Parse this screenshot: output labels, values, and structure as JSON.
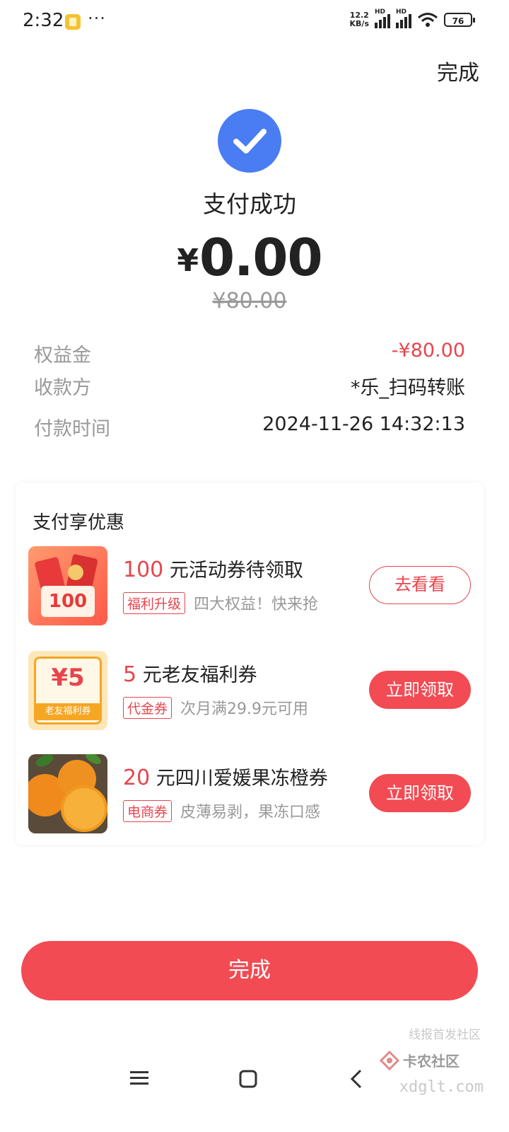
{
  "status_bar": {
    "time": "2:32",
    "dots": "···",
    "net_speed_value": "12.2",
    "net_speed_unit": "KB/s",
    "hd1": "HD",
    "hd2": "HD",
    "battery": "76"
  },
  "header": {
    "done_label": "完成"
  },
  "result": {
    "title": "支付成功",
    "currency": "¥",
    "amount": "0.00",
    "original_amount": "¥80.00"
  },
  "details": [
    {
      "label": "权益金",
      "value": "-¥80.00",
      "highlight": true
    },
    {
      "label": "收款方",
      "value": "*乐_扫码转账"
    },
    {
      "label": "付款时间",
      "value": "2024-11-26 14:32:13"
    }
  ],
  "promo": {
    "title": "支付享优惠",
    "offers": [
      {
        "amount": "100",
        "title": "元活动券待领取",
        "tag": "福利升级",
        "desc": "四大权益！快来抢",
        "button": "去看看",
        "thumb_label": "100"
      },
      {
        "amount": "5",
        "title": "元老友福利券",
        "tag": "代金券",
        "desc": "次月满29.9元可用",
        "button": "立即领取",
        "thumb_label": "¥5",
        "thumb_caption": "老友福利券"
      },
      {
        "amount": "20",
        "title": "元四川爱媛果冻橙券",
        "tag": "电商券",
        "desc": "皮薄易剥，果冻口感",
        "button": "立即领取"
      }
    ]
  },
  "bottom_button": {
    "label": "完成"
  },
  "watermark": {
    "line1": "线报首发社区",
    "brand": "卡农社区",
    "domain": "xdglt.com"
  },
  "colors": {
    "accent": "#f24b54",
    "check": "#4a7cf2"
  }
}
